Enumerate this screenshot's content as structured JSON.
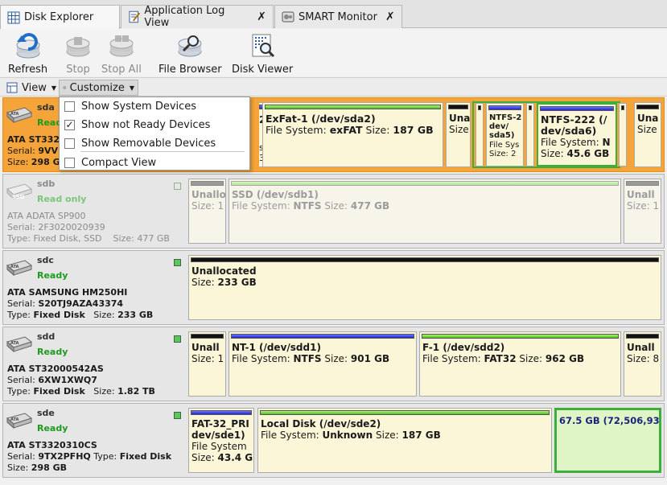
{
  "tabs": [
    {
      "label": "Disk Explorer",
      "icon": "grid-icon",
      "closable": false,
      "active": true
    },
    {
      "label": "Application Log View",
      "icon": "log-icon",
      "closable": true
    },
    {
      "label": "SMART Monitor",
      "icon": "smart-monitor-icon",
      "closable": true
    }
  ],
  "toolbar": {
    "refresh": "Refresh",
    "stop": "Stop",
    "stop_all": "Stop All",
    "file_browser": "File Browser",
    "disk_viewer": "Disk Viewer"
  },
  "viewbar": {
    "view": "View",
    "customize": "Customize"
  },
  "menu": {
    "show_system": "Show System Devices",
    "show_not_ready": "Show not Ready Devices",
    "show_removable": "Show Removable Devices",
    "compact": "Compact View",
    "checked": [
      "show_not_ready"
    ]
  },
  "disks": [
    {
      "name": "sda",
      "status": "Ready",
      "model": "ATA ST332",
      "serial_prefix": "Serial: ",
      "serial": "9VVI",
      "size_label": "Size: ",
      "size": "298 G",
      "partitions": [
        {
          "title": "2",
          "fs": "s",
          "extra": "3"
        },
        {
          "title": "ExFat-1 (/dev/sda2)",
          "fs_label": "File System: ",
          "fs": "exFAT",
          "size_label": " Size: ",
          "size": "187 GB"
        },
        {
          "title": "Una",
          "size_label": "Size"
        },
        {
          "title": "NTFS-2",
          "line2": "dev/",
          "line3": "sda5)",
          "fs_label": "File Sys",
          "size_label": "Size: 2"
        },
        {
          "title": "NTFS-222 (/",
          "line2": "dev/sda6)",
          "fs_label": "File System: ",
          "fs": "N",
          "size_label": "Size: ",
          "size": "45.6 GB"
        },
        {
          "title": "Una",
          "size_label": "Size"
        }
      ]
    },
    {
      "name": "sdb",
      "status": "Read only",
      "model": "ATA ADATA SP900",
      "serial_prefix": "Serial: ",
      "serial": "2F3020020939",
      "type_label": "Type: ",
      "type": "Fixed Disk, SSD",
      "size_label": "Size: ",
      "size": "477 GB",
      "partitions": [
        {
          "title": "Unallo",
          "size_label": "Size: ",
          "size": "1"
        },
        {
          "title": "SSD (/dev/sdb1)",
          "fs_label": "File System: ",
          "fs": "NTFS",
          "size_label": " Size: ",
          "size": "477 GB"
        },
        {
          "title": "Unall",
          "size_label": "Size: ",
          "size": "1"
        }
      ]
    },
    {
      "name": "sdc",
      "status": "Ready",
      "model": "ATA SAMSUNG HM250HI",
      "serial_prefix": "Serial: ",
      "serial": "S20TJ9AZA43374",
      "type_label": "Type: ",
      "type": "Fixed Disk",
      "size_label": "Size: ",
      "size": "233 GB",
      "partitions": [
        {
          "title": "Unallocated",
          "size_label": "Size: ",
          "size": "233 GB"
        }
      ]
    },
    {
      "name": "sdd",
      "status": "Ready",
      "model": "ATA ST32000542AS",
      "serial_prefix": "Serial: ",
      "serial": "6XW1XWQ7",
      "type_label": "Type: ",
      "type": "Fixed Disk",
      "size_label": "Size: ",
      "size": "1.82 TB",
      "partitions": [
        {
          "title": "Unall",
          "size_label": "Size: ",
          "size": "1"
        },
        {
          "title": "NT-1 (/dev/sdd1)",
          "fs_label": "File System: ",
          "fs": "NTFS",
          "size_label": " Size: ",
          "size": "901 GB"
        },
        {
          "title": "F-1 (/dev/sdd2)",
          "fs_label": "File System: ",
          "fs": "FAT32",
          "size_label": " Size: ",
          "size": "962 GB"
        },
        {
          "title": "Unall",
          "size_label": "Size: ",
          "size": "8"
        }
      ]
    },
    {
      "name": "sde",
      "status": "Ready",
      "model": "ATA ST3320310CS",
      "serial_prefix": "Serial: ",
      "serial": "9TX2PFHQ",
      "type_label": "Type: ",
      "type": "Fixed Disk",
      "size_label": "Size: ",
      "size": "298 GB",
      "partitions": [
        {
          "title": "FAT-32_PRI",
          "line2": "dev/sde1)",
          "fs_label": "File System",
          "size_label": "Size: ",
          "size": "43.4 G"
        },
        {
          "title": "Local Disk (/dev/sde2)",
          "fs_label": "File System: ",
          "fs": "Unknown",
          "size_label": " Size: ",
          "size": "187 GB"
        },
        {
          "title": "67.5 GB (72,506,93"
        }
      ]
    }
  ],
  "colors": {
    "selected": "#f4a438",
    "ready": "#1e9a1e",
    "partition_bg": "#fbf6d8",
    "free_bg": "#dff5c6"
  }
}
